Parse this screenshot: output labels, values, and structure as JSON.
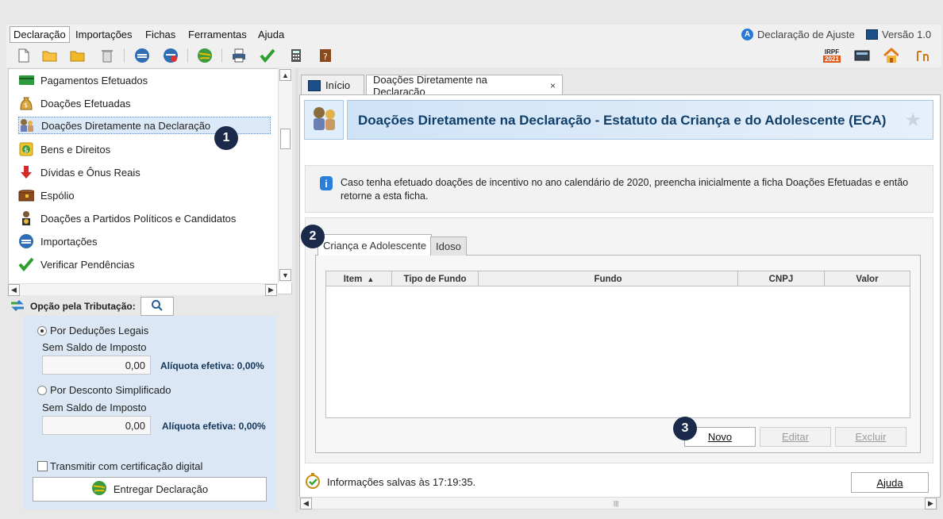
{
  "menu": {
    "items": [
      "Declaração",
      "Importações",
      "Fichas",
      "Ferramentas",
      "Ajuda"
    ],
    "declaration_type": "Declaração de Ajuste",
    "version": "Versão 1.0"
  },
  "toolbar": {
    "right_badge_top": "IRPF",
    "right_badge_year": "2021"
  },
  "sidebar": {
    "items": [
      {
        "label": "Pagamentos Efetuados",
        "icon": "payment-card-icon"
      },
      {
        "label": "Doações Efetuadas",
        "icon": "money-bag-icon"
      },
      {
        "label": "Doações Diretamente na Declaração",
        "icon": "people-donation-icon",
        "selected": true
      },
      {
        "label": "Bens e Direitos",
        "icon": "assets-icon"
      },
      {
        "label": "Dívidas e Ônus Reais",
        "icon": "debt-arrow-icon"
      },
      {
        "label": "Espólio",
        "icon": "chest-icon"
      },
      {
        "label": "Doações a Partidos Políticos e Candidatos",
        "icon": "political-donation-icon"
      },
      {
        "label": "Importações",
        "icon": "import-icon"
      },
      {
        "label": "Verificar Pendências",
        "icon": "checkmark-icon"
      }
    ]
  },
  "tributacao": {
    "header": "Opção pela Tributação:",
    "option1_label": "Por Deduções Legais",
    "option1_sub": "Sem Saldo de Imposto",
    "option1_value": "0,00",
    "option1_aliquota": "Alíquota efetiva: 0,00%",
    "option2_label": "Por Desconto Simplificado",
    "option2_sub": "Sem Saldo de Imposto",
    "option2_value": "0,00",
    "option2_aliquota": "Alíquota efetiva: 0,00%",
    "cert_label": "Transmitir com certificação digital",
    "deliver_label": "Entregar Declaração"
  },
  "tabs": {
    "home": "Início",
    "current": "Doações Diretamente na Declaração",
    "close": "×"
  },
  "banner": {
    "title": "Doações Diretamente na Declaração - Estatuto da Criança e do Adolescente (ECA)"
  },
  "info": {
    "text": "Caso tenha efetuado doações de incentivo no ano calendário de 2020, preencha inicialmente a ficha Doações Efetuadas e então retorne a esta ficha."
  },
  "subtabs": [
    "Criança e Adolescente",
    "Idoso"
  ],
  "table": {
    "columns": [
      "Item",
      "Tipo de Fundo",
      "Fundo",
      "CNPJ",
      "Valor"
    ],
    "sort_indicator": "▲",
    "rows": []
  },
  "buttons": {
    "novo": "Novo",
    "editar": "Editar",
    "excluir": "Excluir",
    "ajuda": "Ajuda"
  },
  "status": {
    "text": "Informações salvas às 17:19:35."
  },
  "callouts": [
    "1",
    "2",
    "3"
  ],
  "colors": {
    "accent": "#103e6a",
    "selected_bg": "#dce9f8",
    "panel_bg": "#dbe7f4",
    "callout": "#1b2a4a"
  }
}
